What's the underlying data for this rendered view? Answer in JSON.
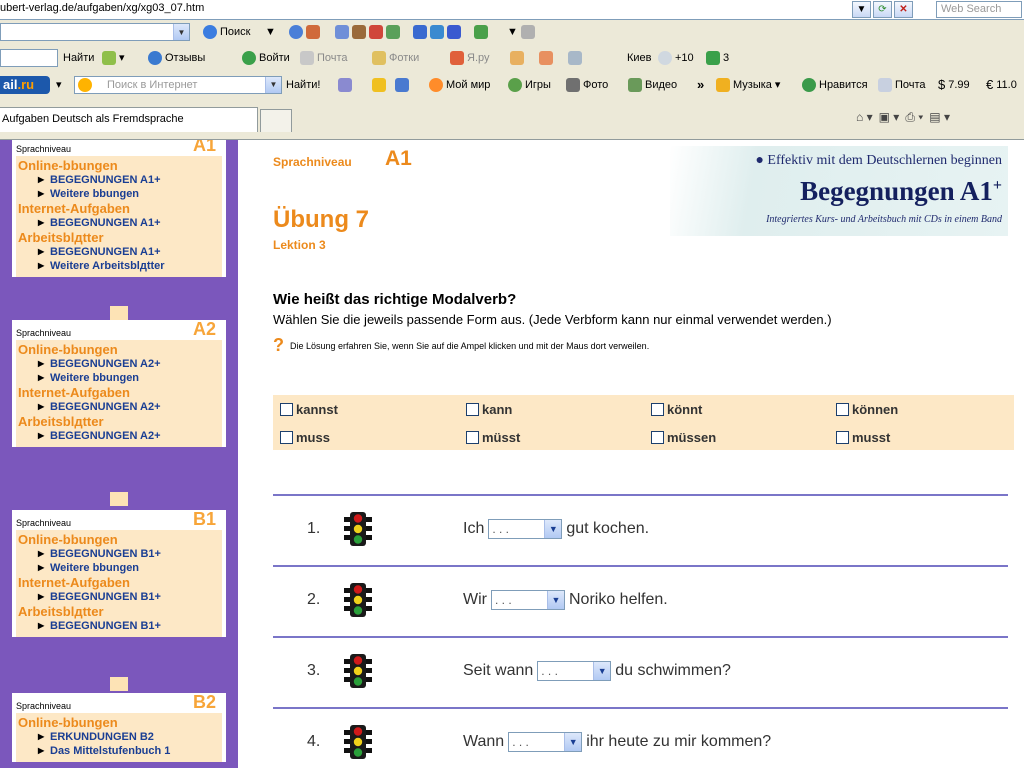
{
  "browser": {
    "url": "ubert-verlag.de/aufgaben/xg/xg03_07.htm",
    "web_search_placeholder": "Web Search",
    "toolbar1": {
      "search": "Поиск",
      "dropdown_arrow": "▼",
      "bookmark_arrow": "▼"
    },
    "toolbar2": {
      "find": "Найти",
      "reviews": "Отзывы",
      "login": "Войти",
      "mail": "Почта",
      "photos": "Фотки",
      "yaru": "Я.ру",
      "city": "Киев",
      "weather": "+10",
      "count": "3"
    },
    "toolbar3": {
      "logo_main": "ail",
      "logo_suffix": ".ru",
      "search_placeholder": "Поиск в Интернет",
      "find": "Найти!",
      "my_world": "Мой мир",
      "games": "Игры",
      "photo": "Фото",
      "video": "Видео",
      "more": "»",
      "music": "Музыка",
      "likes": "Нравится",
      "mail": "Почта",
      "price_usd": "7.99",
      "price_eur": "11.0"
    },
    "tab_title": "Aufgaben Deutsch als Fremdsprache"
  },
  "sidebar": {
    "boxes": [
      {
        "level_label": "Sprachniveau",
        "level_code": "A1",
        "sections": [
          {
            "title": "Online-bbungen",
            "items": [
              "BEGEGNUNGEN A1+",
              "Weitere bbungen"
            ]
          },
          {
            "title": "Internet-Aufgaben",
            "items": [
              "BEGEGNUNGEN A1+"
            ]
          },
          {
            "title": "Arbeitsblдtter",
            "items": [
              "BEGEGNUNGEN A1+",
              "Weitere Arbeitsblдtter"
            ]
          }
        ]
      },
      {
        "level_label": "Sprachniveau",
        "level_code": "A2",
        "sections": [
          {
            "title": "Online-bbungen",
            "items": [
              "BEGEGNUNGEN A2+",
              "Weitere bbungen"
            ]
          },
          {
            "title": "Internet-Aufgaben",
            "items": [
              "BEGEGNUNGEN A2+"
            ]
          },
          {
            "title": "Arbeitsblдtter",
            "items": [
              "BEGEGNUNGEN A2+"
            ]
          }
        ]
      },
      {
        "level_label": "Sprachniveau",
        "level_code": "B1",
        "sections": [
          {
            "title": "Online-bbungen",
            "items": [
              "BEGEGNUNGEN B1+",
              "Weitere bbungen"
            ]
          },
          {
            "title": "Internet-Aufgaben",
            "items": [
              "BEGEGNUNGEN B1+"
            ]
          },
          {
            "title": "Arbeitsblдtter",
            "items": [
              "BEGEGNUNGEN B1+"
            ]
          }
        ]
      },
      {
        "level_label": "Sprachniveau",
        "level_code": "B2",
        "sections": [
          {
            "title": "Online-bbungen",
            "items": [
              "ERKUNDUNGEN B2",
              "Das Mittelstufenbuch 1"
            ]
          }
        ]
      }
    ]
  },
  "main": {
    "level_small": "Sprachniveau",
    "level_big": "A1",
    "exercise_title": "Übung 7",
    "lesson": "Lektion 3",
    "banner": {
      "tagline": "● Effektiv mit dem Deutschlernen beginnen",
      "title": "Begegnungen A1",
      "title_sup": "+",
      "subtitle": "Integriertes Kurs- und Arbeitsbuch mit CDs in einem Band"
    },
    "question_title": "Wie heißt das richtige Modalverb?",
    "instruction": "Wählen Sie die jeweils passende Form aus. (Jede Verbform kann nur einmal verwendet werden.)",
    "hint_mark": "?",
    "hint": "Die Lösung erfahren Sie, wenn Sie auf die Ampel klicken und mit der Maus dort verweilen.",
    "words": [
      "kannst",
      "kann",
      "könnt",
      "können",
      "muss",
      "müsst",
      "müssen",
      "musst"
    ],
    "exercises": [
      {
        "num": "1.",
        "before": "Ich",
        "select": ". . .",
        "after": "gut kochen."
      },
      {
        "num": "2.",
        "before": "Wir",
        "select": ". . .",
        "after": "Noriko helfen."
      },
      {
        "num": "3.",
        "before": "Seit wann",
        "select": ". . .",
        "after": "du schwimmen?"
      },
      {
        "num": "4.",
        "before": "Wann",
        "select": ". . .",
        "after": "ihr heute zu mir kommen?"
      }
    ]
  },
  "colors": {
    "accent_orange": "#ec8a1c",
    "sidebar_purple": "#7b57bc",
    "list_bg": "#fde8c6",
    "link_blue": "#1a3e93",
    "rule_purple": "#7a75c8"
  }
}
